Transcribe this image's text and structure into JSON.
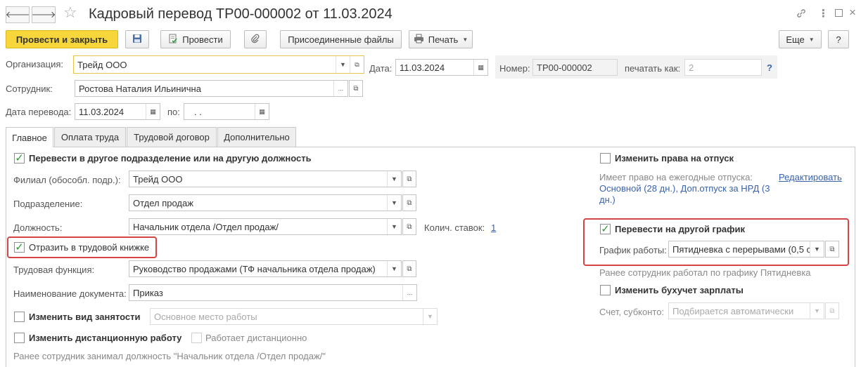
{
  "window": {
    "title": "Кадровый перевод ТР00-000002 от 11.03.2024"
  },
  "toolbar": {
    "post_close": "Провести и закрыть",
    "post": "Провести",
    "attached_files": "Присоединенные файлы",
    "print": "Печать",
    "more": "Еще",
    "help": "?"
  },
  "header": {
    "org_label": "Организация:",
    "org_value": "Трейд ООО",
    "date_label": "Дата:",
    "date_value": "11.03.2024",
    "number_label": "Номер:",
    "number_value": "ТР00-000002",
    "print_as_label": "печатать как:",
    "print_as_value": "2",
    "help_mark": "?",
    "employee_label": "Сотрудник:",
    "employee_value": "Ростова Наталия Ильинична",
    "transfer_date_label": "Дата перевода:",
    "transfer_date_value": "11.03.2024",
    "to_label": "по:",
    "to_value": " .  ."
  },
  "tabs": [
    {
      "label": "Главное"
    },
    {
      "label": "Оплата труда"
    },
    {
      "label": "Трудовой договор"
    },
    {
      "label": "Дополнительно"
    }
  ],
  "main": {
    "transfer_dept_label": "Перевести в другое подразделение или на другую должность",
    "branch_label": "Филиал (обособл. подр.):",
    "branch_value": "Трейд ООО",
    "dept_label": "Подразделение:",
    "dept_value": "Отдел продаж",
    "position_label": "Должность:",
    "position_value": "Начальник отдела /Отдел продаж/",
    "rates_label": "Колич. ставок:",
    "rates_value": "1",
    "workbook_label": "Отразить в трудовой книжке",
    "labor_func_label": "Трудовая функция:",
    "labor_func_value": "Руководство продажами (ТФ начальника отдела продаж)",
    "doc_name_label": "Наименование документа:",
    "doc_name_value": "Приказ",
    "change_employment_label": "Изменить вид занятости",
    "employment_value": "Основное место работы",
    "change_remote_label": "Изменить дистанционную работу",
    "remote_label": "Работает дистанционно",
    "prev_position_note": "Ранее сотрудник занимал должность \"Начальник отдела /Отдел продаж/\""
  },
  "right": {
    "vacation_rights_label": "Изменить права на отпуск",
    "vacation_info_line1": "Имеет право на ежегодные отпуска:",
    "vacation_info_line2": "Основной (28 дн.), Доп.отпуск за НРД (3",
    "vacation_info_line3": "дн.)",
    "edit_link": "Редактировать",
    "schedule_transfer_label": "Перевести на другой график",
    "schedule_label": "График работы:",
    "schedule_value": "Пятидневка с перерывами (0,5 с",
    "prev_schedule_note": "Ранее сотрудник работал по графику Пятидневка",
    "payroll_label": "Изменить бухучет зарплаты",
    "account_label": "Счет, субконто:",
    "account_value": "Подбирается автоматически"
  },
  "icons": {
    "back": "arrow-left",
    "forward": "arrow-right",
    "star": "star",
    "link": "link",
    "menu": "vertical-dots",
    "maximize": "square",
    "close": "x",
    "save": "floppy-disk",
    "post": "document-post",
    "clip": "paperclip",
    "printer": "printer",
    "calendar": "calendar",
    "open": "open-window",
    "dropdown": "triangle-down",
    "ellipsis": "ellipsis"
  },
  "colors": {
    "primary_button": "#f7d63b",
    "highlight_border": "#d64545",
    "checkmark": "#2e9b3a",
    "link": "#3a62ad"
  }
}
